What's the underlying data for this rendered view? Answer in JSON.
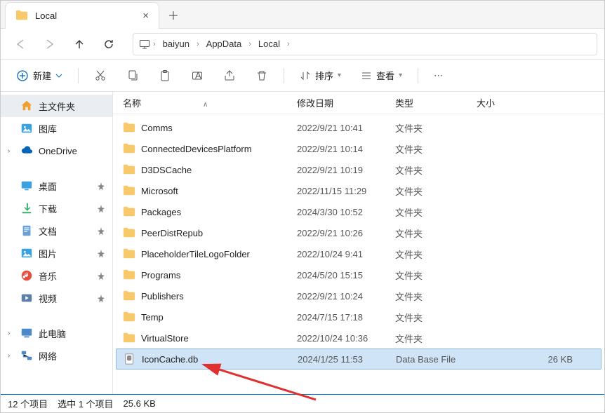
{
  "tab": {
    "title": "Local"
  },
  "breadcrumb": [
    "baiyun",
    "AppData",
    "Local"
  ],
  "toolbar": {
    "new": "新建",
    "sort": "排序",
    "view": "查看"
  },
  "sidebar": {
    "home": "主文件夹",
    "gallery": "图库",
    "onedrive": "OneDrive",
    "pinned": [
      "桌面",
      "下载",
      "文档",
      "图片",
      "音乐",
      "视频"
    ],
    "thispc": "此电脑",
    "network": "网络"
  },
  "columns": {
    "name": "名称",
    "date": "修改日期",
    "type": "类型",
    "size": "大小"
  },
  "files": [
    {
      "name": "Comms",
      "date": "2022/9/21 10:41",
      "type": "文件夹",
      "size": "",
      "kind": "folder"
    },
    {
      "name": "ConnectedDevicesPlatform",
      "date": "2022/9/21 10:14",
      "type": "文件夹",
      "size": "",
      "kind": "folder"
    },
    {
      "name": "D3DSCache",
      "date": "2022/9/21 10:19",
      "type": "文件夹",
      "size": "",
      "kind": "folder"
    },
    {
      "name": "Microsoft",
      "date": "2022/11/15 11:29",
      "type": "文件夹",
      "size": "",
      "kind": "folder"
    },
    {
      "name": "Packages",
      "date": "2024/3/30 10:52",
      "type": "文件夹",
      "size": "",
      "kind": "folder"
    },
    {
      "name": "PeerDistRepub",
      "date": "2022/9/21 10:26",
      "type": "文件夹",
      "size": "",
      "kind": "folder"
    },
    {
      "name": "PlaceholderTileLogoFolder",
      "date": "2022/10/24 9:41",
      "type": "文件夹",
      "size": "",
      "kind": "folder"
    },
    {
      "name": "Programs",
      "date": "2024/5/20 15:15",
      "type": "文件夹",
      "size": "",
      "kind": "folder"
    },
    {
      "name": "Publishers",
      "date": "2022/9/21 10:24",
      "type": "文件夹",
      "size": "",
      "kind": "folder"
    },
    {
      "name": "Temp",
      "date": "2024/7/15 17:18",
      "type": "文件夹",
      "size": "",
      "kind": "folder"
    },
    {
      "name": "VirtualStore",
      "date": "2022/10/24 10:36",
      "type": "文件夹",
      "size": "",
      "kind": "folder"
    },
    {
      "name": "IconCache.db",
      "date": "2024/1/25 11:53",
      "type": "Data Base File",
      "size": "26 KB",
      "kind": "file",
      "selected": true
    }
  ],
  "status": {
    "count": "12 个项目",
    "selection": "选中 1 个项目",
    "selsize": "25.6 KB"
  }
}
